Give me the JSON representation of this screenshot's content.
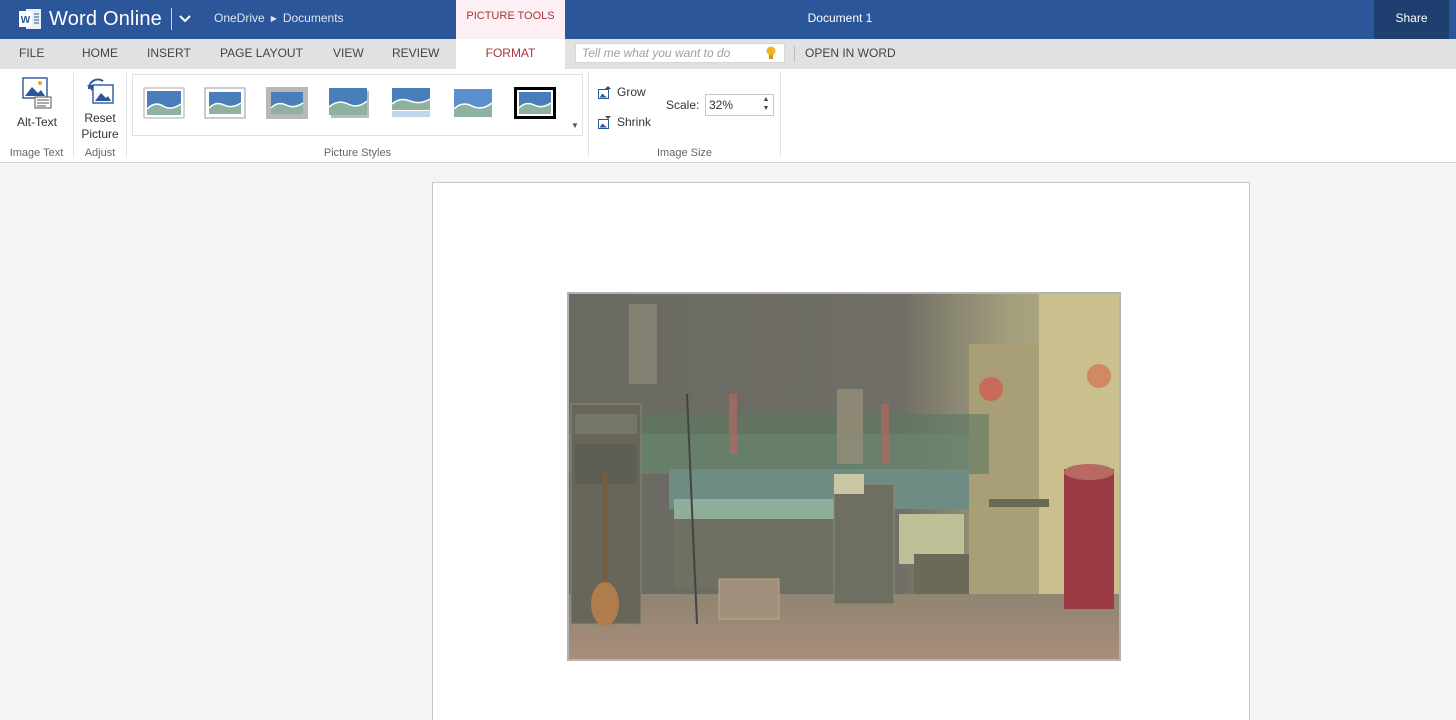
{
  "titlebar": {
    "app_name": "Word Online",
    "breadcrumb": [
      "OneDrive",
      "Documents"
    ],
    "context_tab": "PICTURE TOOLS",
    "document_title": "Document 1",
    "share_label": "Share",
    "brand_color": "#2b579a"
  },
  "tabs": [
    {
      "label": "FILE"
    },
    {
      "label": "HOME"
    },
    {
      "label": "INSERT"
    },
    {
      "label": "PAGE LAYOUT"
    },
    {
      "label": "VIEW"
    },
    {
      "label": "REVIEW"
    },
    {
      "label": "FORMAT",
      "active": true
    }
  ],
  "tellme": {
    "placeholder": "Tell me what you want to do",
    "icon": "lightbulb-icon"
  },
  "open_in_word": "OPEN IN WORD",
  "ribbon": {
    "image_text": {
      "alt_text_label": "Alt-Text",
      "group_label": "Image Text"
    },
    "adjust": {
      "reset_line1": "Reset",
      "reset_line2": "Picture",
      "group_label": "Adjust"
    },
    "picture_styles": {
      "group_label": "Picture Styles",
      "styles": [
        "simple-frame-white",
        "simple-frame-thin",
        "thick-matte-grey",
        "shadow-rectangle",
        "reflected-rectangle",
        "soft-edge-rectangle",
        "double-frame-black"
      ]
    },
    "image_size": {
      "grow_label": "Grow",
      "shrink_label": "Shrink",
      "scale_label": "Scale:",
      "scale_value": "32%",
      "group_label": "Image Size"
    }
  }
}
